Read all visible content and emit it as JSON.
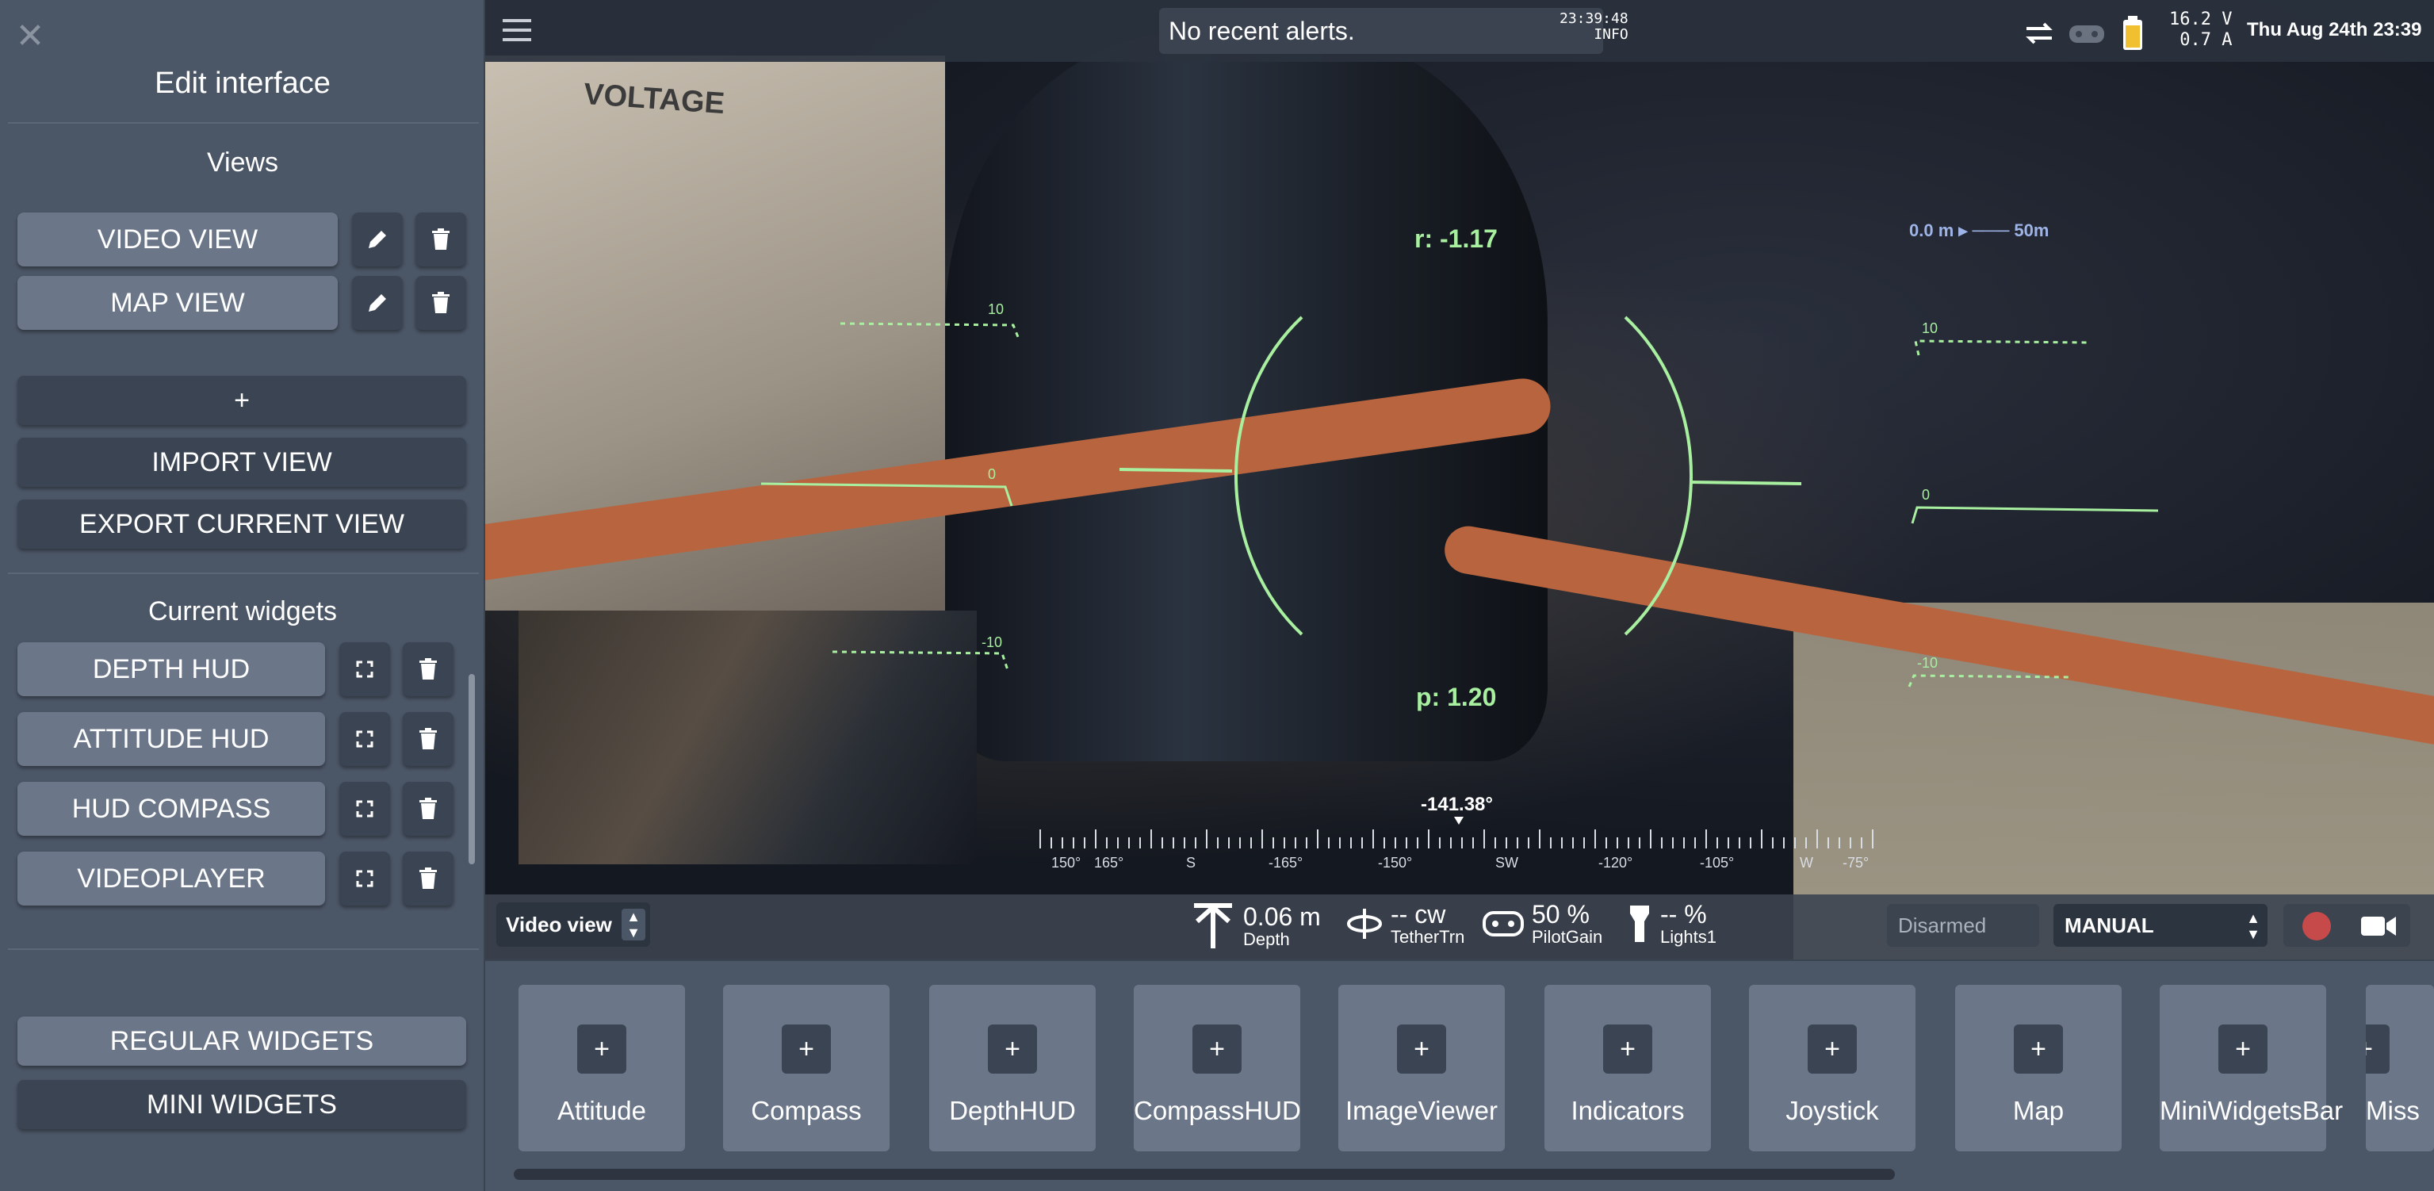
{
  "sidebar": {
    "title": "Edit interface",
    "views_heading": "Views",
    "views": [
      {
        "label": "VIDEO VIEW"
      },
      {
        "label": "MAP VIEW"
      }
    ],
    "add_label": "+",
    "import_label": "IMPORT VIEW",
    "export_label": "EXPORT CURRENT VIEW",
    "widgets_heading": "Current widgets",
    "widgets": [
      {
        "label": "DEPTH HUD"
      },
      {
        "label": "ATTITUDE HUD"
      },
      {
        "label": "HUD COMPASS"
      },
      {
        "label": "VIDEOPLAYER"
      }
    ],
    "regular_widgets_label": "REGULAR WIDGETS",
    "mini_widgets_label": "MINI WIDGETS"
  },
  "topbar": {
    "alert": "No recent alerts.",
    "alert_time": "23:39:48",
    "alert_level": "INFO",
    "voltage": "16.2 V",
    "current": "0.7 A",
    "datetime": "Thu Aug 24th 23:39"
  },
  "video": {
    "label_text": "VOLTAGE"
  },
  "hud": {
    "roll": "r: -1.17",
    "pitch": "p: 1.20",
    "heading": "-141.38°",
    "depth_scale": "0.0 m ▸ ─── 50m",
    "pitch_ticks_left": [
      "10",
      "0",
      "-10"
    ],
    "pitch_ticks_right": [
      "10",
      "0",
      "-10"
    ],
    "compass_ticks": [
      "150°",
      "165°",
      "S",
      "-165°",
      "-150°",
      "SW",
      "-120°",
      "-105°",
      "W",
      "-75°"
    ],
    "color": "#a8f0a0"
  },
  "bottombar": {
    "view_name": "Video view",
    "depth": {
      "value": "0.06 m",
      "label": "Depth"
    },
    "tether": {
      "value": "-- cw",
      "label": "TetherTrn"
    },
    "pilot_gain": {
      "value": "50 %",
      "label": "PilotGain"
    },
    "lights": {
      "value": "-- %",
      "label": "Lights1"
    },
    "arm_state": "Disarmed",
    "flight_mode": "MANUAL",
    "record_color": "#c64a4a"
  },
  "tray": {
    "widgets": [
      {
        "name": "Attitude"
      },
      {
        "name": "Compass"
      },
      {
        "name": "DepthHUD"
      },
      {
        "name": "CompassHUD"
      },
      {
        "name": "ImageViewer"
      },
      {
        "name": "Indicators"
      },
      {
        "name": "Joystick"
      },
      {
        "name": "Map"
      },
      {
        "name": "MiniWidgetsBar"
      },
      {
        "name": "Miss"
      }
    ],
    "add_symbol": "+"
  },
  "icons": {
    "close": "close-icon",
    "menu": "hamburger-menu-icon",
    "edit": "pencil-icon",
    "delete": "trash-icon",
    "fullscreen": "fullscreen-icon",
    "swap": "swap-arrows-icon",
    "joystick": "gamepad-icon",
    "battery": "battery-icon",
    "camera": "video-camera-icon"
  }
}
